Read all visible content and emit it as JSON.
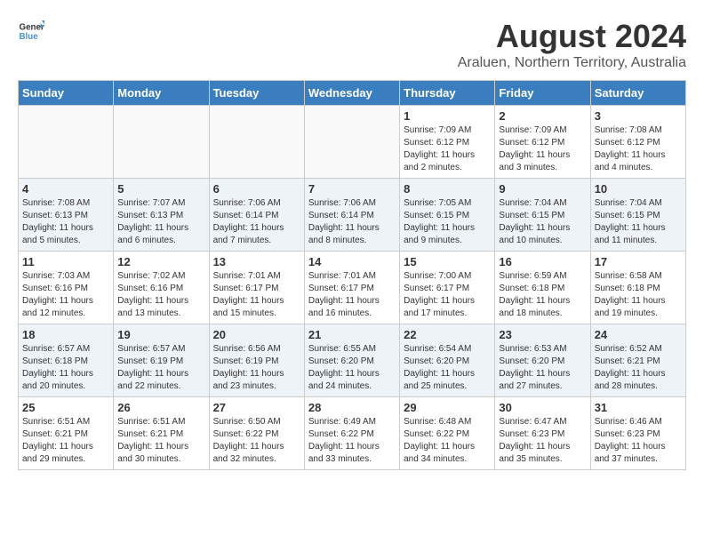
{
  "header": {
    "logo_line1": "General",
    "logo_line2": "Blue",
    "month_year": "August 2024",
    "location": "Araluen, Northern Territory, Australia"
  },
  "days_of_week": [
    "Sunday",
    "Monday",
    "Tuesday",
    "Wednesday",
    "Thursday",
    "Friday",
    "Saturday"
  ],
  "weeks": [
    [
      {
        "day": "",
        "sunrise": "",
        "sunset": "",
        "daylight": ""
      },
      {
        "day": "",
        "sunrise": "",
        "sunset": "",
        "daylight": ""
      },
      {
        "day": "",
        "sunrise": "",
        "sunset": "",
        "daylight": ""
      },
      {
        "day": "",
        "sunrise": "",
        "sunset": "",
        "daylight": ""
      },
      {
        "day": "1",
        "sunrise": "Sunrise: 7:09 AM",
        "sunset": "Sunset: 6:12 PM",
        "daylight": "Daylight: 11 hours and 2 minutes."
      },
      {
        "day": "2",
        "sunrise": "Sunrise: 7:09 AM",
        "sunset": "Sunset: 6:12 PM",
        "daylight": "Daylight: 11 hours and 3 minutes."
      },
      {
        "day": "3",
        "sunrise": "Sunrise: 7:08 AM",
        "sunset": "Sunset: 6:12 PM",
        "daylight": "Daylight: 11 hours and 4 minutes."
      }
    ],
    [
      {
        "day": "4",
        "sunrise": "Sunrise: 7:08 AM",
        "sunset": "Sunset: 6:13 PM",
        "daylight": "Daylight: 11 hours and 5 minutes."
      },
      {
        "day": "5",
        "sunrise": "Sunrise: 7:07 AM",
        "sunset": "Sunset: 6:13 PM",
        "daylight": "Daylight: 11 hours and 6 minutes."
      },
      {
        "day": "6",
        "sunrise": "Sunrise: 7:06 AM",
        "sunset": "Sunset: 6:14 PM",
        "daylight": "Daylight: 11 hours and 7 minutes."
      },
      {
        "day": "7",
        "sunrise": "Sunrise: 7:06 AM",
        "sunset": "Sunset: 6:14 PM",
        "daylight": "Daylight: 11 hours and 8 minutes."
      },
      {
        "day": "8",
        "sunrise": "Sunrise: 7:05 AM",
        "sunset": "Sunset: 6:15 PM",
        "daylight": "Daylight: 11 hours and 9 minutes."
      },
      {
        "day": "9",
        "sunrise": "Sunrise: 7:04 AM",
        "sunset": "Sunset: 6:15 PM",
        "daylight": "Daylight: 11 hours and 10 minutes."
      },
      {
        "day": "10",
        "sunrise": "Sunrise: 7:04 AM",
        "sunset": "Sunset: 6:15 PM",
        "daylight": "Daylight: 11 hours and 11 minutes."
      }
    ],
    [
      {
        "day": "11",
        "sunrise": "Sunrise: 7:03 AM",
        "sunset": "Sunset: 6:16 PM",
        "daylight": "Daylight: 11 hours and 12 minutes."
      },
      {
        "day": "12",
        "sunrise": "Sunrise: 7:02 AM",
        "sunset": "Sunset: 6:16 PM",
        "daylight": "Daylight: 11 hours and 13 minutes."
      },
      {
        "day": "13",
        "sunrise": "Sunrise: 7:01 AM",
        "sunset": "Sunset: 6:17 PM",
        "daylight": "Daylight: 11 hours and 15 minutes."
      },
      {
        "day": "14",
        "sunrise": "Sunrise: 7:01 AM",
        "sunset": "Sunset: 6:17 PM",
        "daylight": "Daylight: 11 hours and 16 minutes."
      },
      {
        "day": "15",
        "sunrise": "Sunrise: 7:00 AM",
        "sunset": "Sunset: 6:17 PM",
        "daylight": "Daylight: 11 hours and 17 minutes."
      },
      {
        "day": "16",
        "sunrise": "Sunrise: 6:59 AM",
        "sunset": "Sunset: 6:18 PM",
        "daylight": "Daylight: 11 hours and 18 minutes."
      },
      {
        "day": "17",
        "sunrise": "Sunrise: 6:58 AM",
        "sunset": "Sunset: 6:18 PM",
        "daylight": "Daylight: 11 hours and 19 minutes."
      }
    ],
    [
      {
        "day": "18",
        "sunrise": "Sunrise: 6:57 AM",
        "sunset": "Sunset: 6:18 PM",
        "daylight": "Daylight: 11 hours and 20 minutes."
      },
      {
        "day": "19",
        "sunrise": "Sunrise: 6:57 AM",
        "sunset": "Sunset: 6:19 PM",
        "daylight": "Daylight: 11 hours and 22 minutes."
      },
      {
        "day": "20",
        "sunrise": "Sunrise: 6:56 AM",
        "sunset": "Sunset: 6:19 PM",
        "daylight": "Daylight: 11 hours and 23 minutes."
      },
      {
        "day": "21",
        "sunrise": "Sunrise: 6:55 AM",
        "sunset": "Sunset: 6:20 PM",
        "daylight": "Daylight: 11 hours and 24 minutes."
      },
      {
        "day": "22",
        "sunrise": "Sunrise: 6:54 AM",
        "sunset": "Sunset: 6:20 PM",
        "daylight": "Daylight: 11 hours and 25 minutes."
      },
      {
        "day": "23",
        "sunrise": "Sunrise: 6:53 AM",
        "sunset": "Sunset: 6:20 PM",
        "daylight": "Daylight: 11 hours and 27 minutes."
      },
      {
        "day": "24",
        "sunrise": "Sunrise: 6:52 AM",
        "sunset": "Sunset: 6:21 PM",
        "daylight": "Daylight: 11 hours and 28 minutes."
      }
    ],
    [
      {
        "day": "25",
        "sunrise": "Sunrise: 6:51 AM",
        "sunset": "Sunset: 6:21 PM",
        "daylight": "Daylight: 11 hours and 29 minutes."
      },
      {
        "day": "26",
        "sunrise": "Sunrise: 6:51 AM",
        "sunset": "Sunset: 6:21 PM",
        "daylight": "Daylight: 11 hours and 30 minutes."
      },
      {
        "day": "27",
        "sunrise": "Sunrise: 6:50 AM",
        "sunset": "Sunset: 6:22 PM",
        "daylight": "Daylight: 11 hours and 32 minutes."
      },
      {
        "day": "28",
        "sunrise": "Sunrise: 6:49 AM",
        "sunset": "Sunset: 6:22 PM",
        "daylight": "Daylight: 11 hours and 33 minutes."
      },
      {
        "day": "29",
        "sunrise": "Sunrise: 6:48 AM",
        "sunset": "Sunset: 6:22 PM",
        "daylight": "Daylight: 11 hours and 34 minutes."
      },
      {
        "day": "30",
        "sunrise": "Sunrise: 6:47 AM",
        "sunset": "Sunset: 6:23 PM",
        "daylight": "Daylight: 11 hours and 35 minutes."
      },
      {
        "day": "31",
        "sunrise": "Sunrise: 6:46 AM",
        "sunset": "Sunset: 6:23 PM",
        "daylight": "Daylight: 11 hours and 37 minutes."
      }
    ]
  ]
}
